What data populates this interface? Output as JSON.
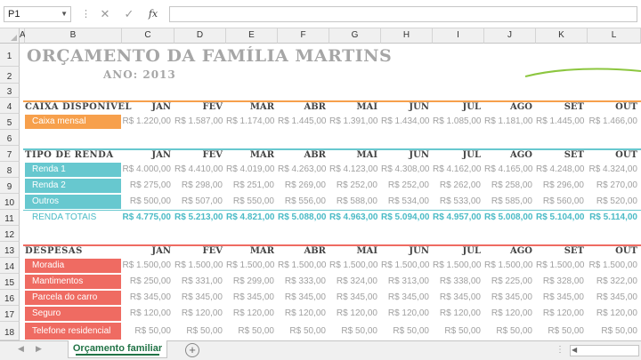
{
  "formula_bar": {
    "name_box": "P1",
    "cancel_icon": "✕",
    "enter_icon": "✓",
    "function_icon": "fx",
    "formula": ""
  },
  "columns": [
    "A",
    "B",
    "C",
    "D",
    "E",
    "F",
    "G",
    "H",
    "I",
    "J",
    "K",
    "L"
  ],
  "rows": [
    "1",
    "2",
    "3",
    "4",
    "5",
    "6",
    "7",
    "8",
    "9",
    "10",
    "11",
    "12",
    "13",
    "14",
    "15",
    "16",
    "17",
    "18"
  ],
  "sheet": {
    "title": "ORÇAMENTO DA FAMÍLIA MARTINS",
    "year": "ANO: 2013",
    "months": [
      "JAN",
      "FEV",
      "MAR",
      "ABR",
      "MAI",
      "JUN",
      "JUL",
      "AGO",
      "SET",
      "OUT"
    ],
    "caixa": {
      "heading": "CAIXA DISPONÍVEL",
      "label": "Caixa mensal",
      "values": [
        "R$ 1.220,00",
        "R$ 1.587,00",
        "R$ 1.174,00",
        "R$ 1.445,00",
        "R$ 1.391,00",
        "R$ 1.434,00",
        "R$ 1.085,00",
        "R$ 1.181,00",
        "R$ 1.445,00",
        "R$ 1.466,00"
      ]
    },
    "renda": {
      "heading": "TIPO DE RENDA",
      "items": [
        {
          "label": "Renda 1",
          "values": [
            "R$ 4.000,00",
            "R$ 4.410,00",
            "R$ 4.019,00",
            "R$ 4.263,00",
            "R$ 4.123,00",
            "R$ 4.308,00",
            "R$ 4.162,00",
            "R$ 4.165,00",
            "R$ 4.248,00",
            "R$ 4.324,00"
          ]
        },
        {
          "label": "Renda 2",
          "values": [
            "R$ 275,00",
            "R$ 298,00",
            "R$ 251,00",
            "R$ 269,00",
            "R$ 252,00",
            "R$ 252,00",
            "R$ 262,00",
            "R$ 258,00",
            "R$ 296,00",
            "R$ 270,00"
          ]
        },
        {
          "label": "Outros",
          "values": [
            "R$ 500,00",
            "R$ 507,00",
            "R$ 550,00",
            "R$ 556,00",
            "R$ 588,00",
            "R$ 534,00",
            "R$ 533,00",
            "R$ 585,00",
            "R$ 560,00",
            "R$ 520,00"
          ]
        }
      ],
      "total_label": "RENDA TOTAIS",
      "totals": [
        "R$ 4.775,00",
        "R$ 5.213,00",
        "R$ 4.821,00",
        "R$ 5.088,00",
        "R$ 4.963,00",
        "R$ 5.094,00",
        "R$ 4.957,00",
        "R$ 5.008,00",
        "R$ 5.104,00",
        "R$ 5.114,00"
      ]
    },
    "despesas": {
      "heading": "DESPESAS",
      "items": [
        {
          "label": "Moradia",
          "values": [
            "R$ 1.500,00",
            "R$ 1.500,00",
            "R$ 1.500,00",
            "R$ 1.500,00",
            "R$ 1.500,00",
            "R$ 1.500,00",
            "R$ 1.500,00",
            "R$ 1.500,00",
            "R$ 1.500,00",
            "R$ 1.500,00"
          ]
        },
        {
          "label": "Mantimentos",
          "values": [
            "R$ 250,00",
            "R$ 331,00",
            "R$ 299,00",
            "R$ 333,00",
            "R$ 324,00",
            "R$ 313,00",
            "R$ 338,00",
            "R$ 225,00",
            "R$ 328,00",
            "R$ 322,00"
          ]
        },
        {
          "label": "Parcela do carro",
          "values": [
            "R$ 345,00",
            "R$ 345,00",
            "R$ 345,00",
            "R$ 345,00",
            "R$ 345,00",
            "R$ 345,00",
            "R$ 345,00",
            "R$ 345,00",
            "R$ 345,00",
            "R$ 345,00"
          ]
        },
        {
          "label": "Seguro",
          "values": [
            "R$ 120,00",
            "R$ 120,00",
            "R$ 120,00",
            "R$ 120,00",
            "R$ 120,00",
            "R$ 120,00",
            "R$ 120,00",
            "R$ 120,00",
            "R$ 120,00",
            "R$ 120,00"
          ]
        },
        {
          "label": "Telefone residencial",
          "values": [
            "R$ 50,00",
            "R$ 50,00",
            "R$ 50,00",
            "R$ 50,00",
            "R$ 50,00",
            "R$ 50,00",
            "R$ 50,00",
            "R$ 50,00",
            "R$ 50,00",
            "R$ 50,00"
          ]
        }
      ]
    }
  },
  "tabs": {
    "active": "Orçamento familiar",
    "add_icon": "+"
  },
  "colors": {
    "orange": "#f7a04c",
    "teal": "#67c8cf",
    "red": "#ef6b62",
    "green_accent": "#8cc63f",
    "title_gray": "#a6a6a6"
  }
}
